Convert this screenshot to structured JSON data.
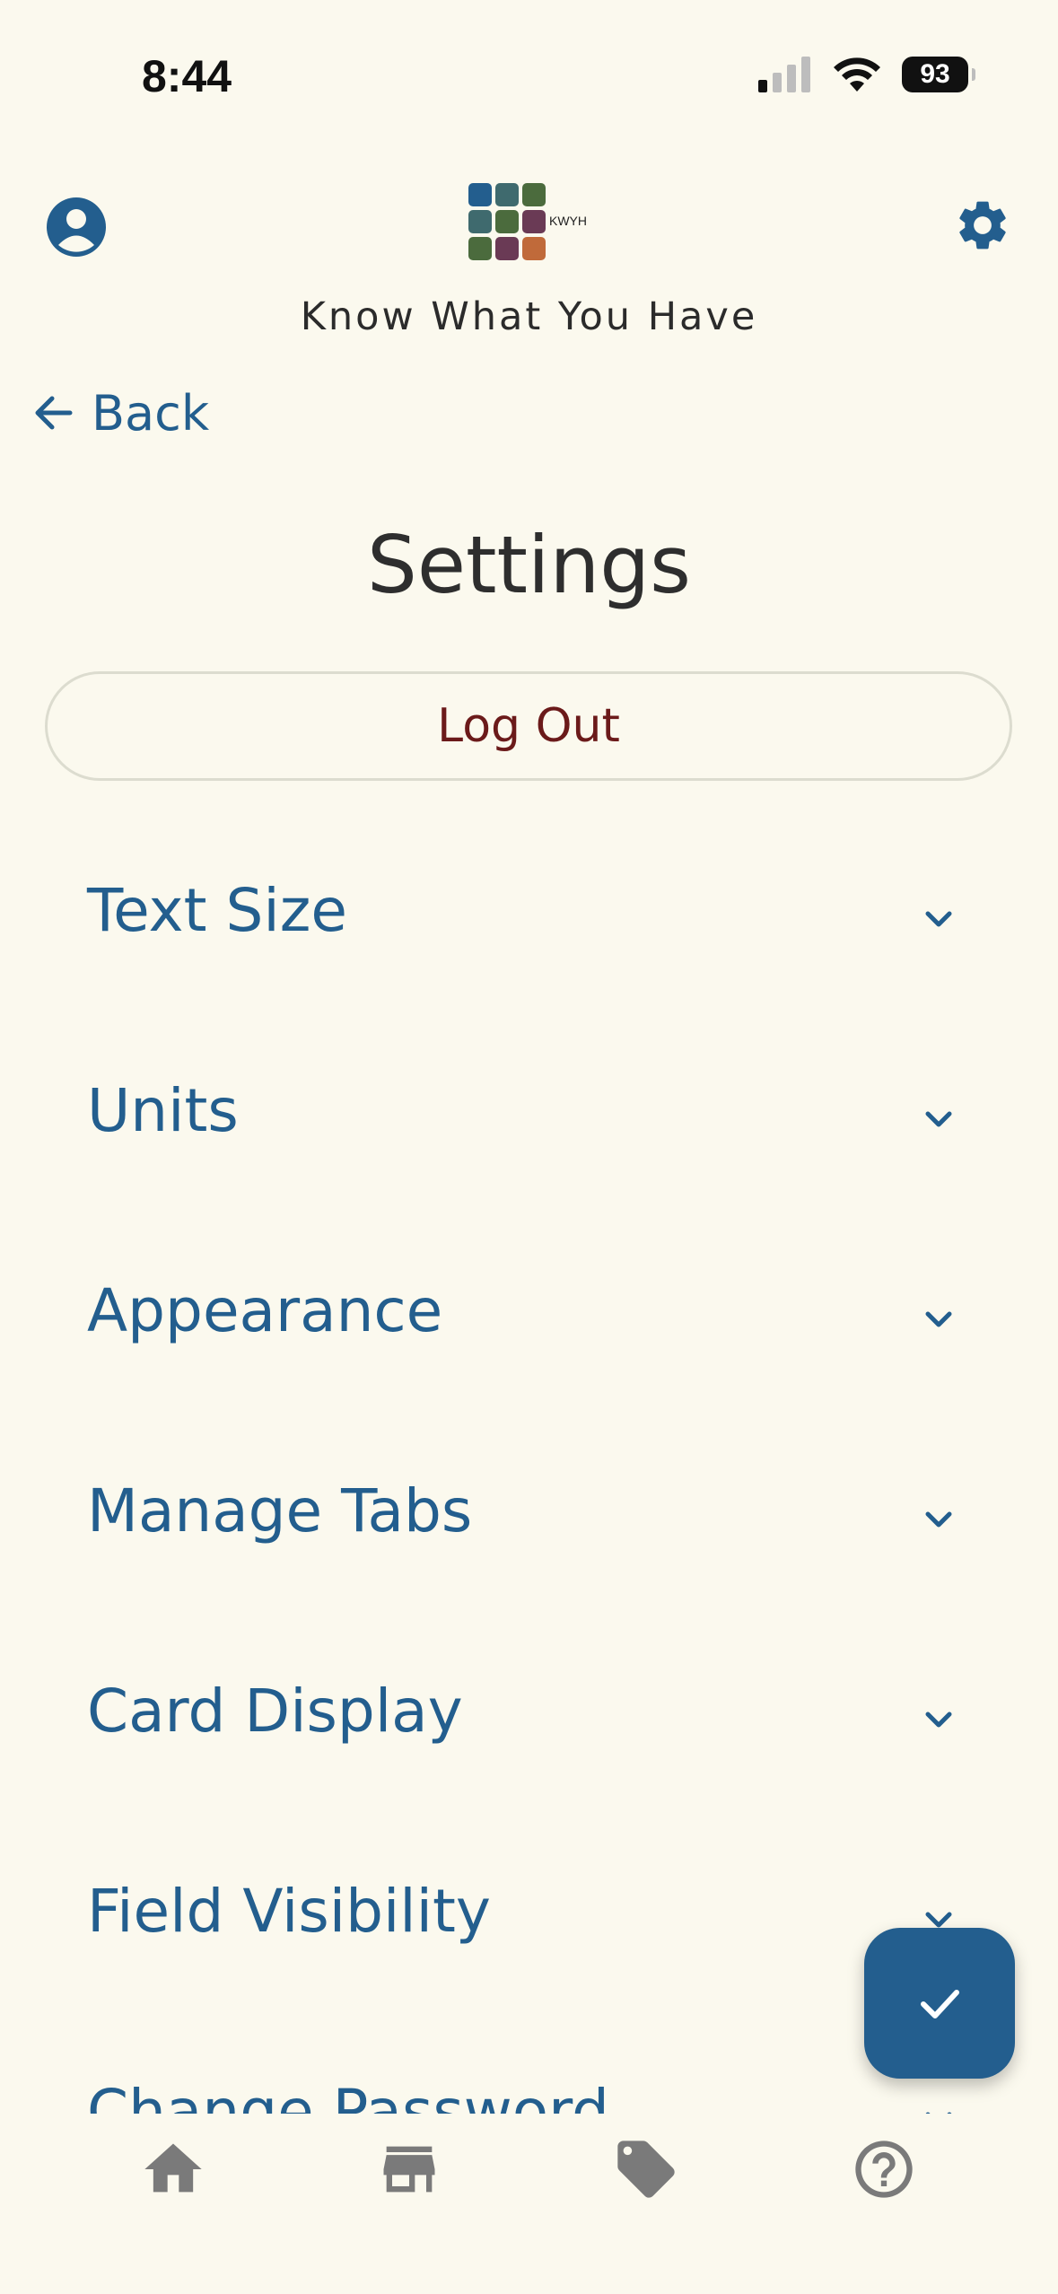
{
  "status": {
    "time": "8:44",
    "battery": "93"
  },
  "header": {
    "logo_text": "KWYH",
    "app_title": "Know What You Have"
  },
  "nav": {
    "back_label": "Back"
  },
  "page": {
    "title": "Settings",
    "logout_label": "Log Out"
  },
  "sections": [
    {
      "label": "Text Size"
    },
    {
      "label": "Units"
    },
    {
      "label": "Appearance"
    },
    {
      "label": "Manage Tabs"
    },
    {
      "label": "Card Display"
    },
    {
      "label": "Field Visibility"
    },
    {
      "label": "Change Password"
    }
  ],
  "bottom_nav": [
    {
      "icon": "home-icon"
    },
    {
      "icon": "store-icon"
    },
    {
      "icon": "tag-icon"
    },
    {
      "icon": "help-icon"
    }
  ],
  "colors": {
    "background": "#fbf9ee",
    "accent": "#235e8e",
    "logout": "#6b1a1a",
    "nav_icon": "#7a7a7a"
  },
  "fab": {
    "icon": "check-icon"
  }
}
